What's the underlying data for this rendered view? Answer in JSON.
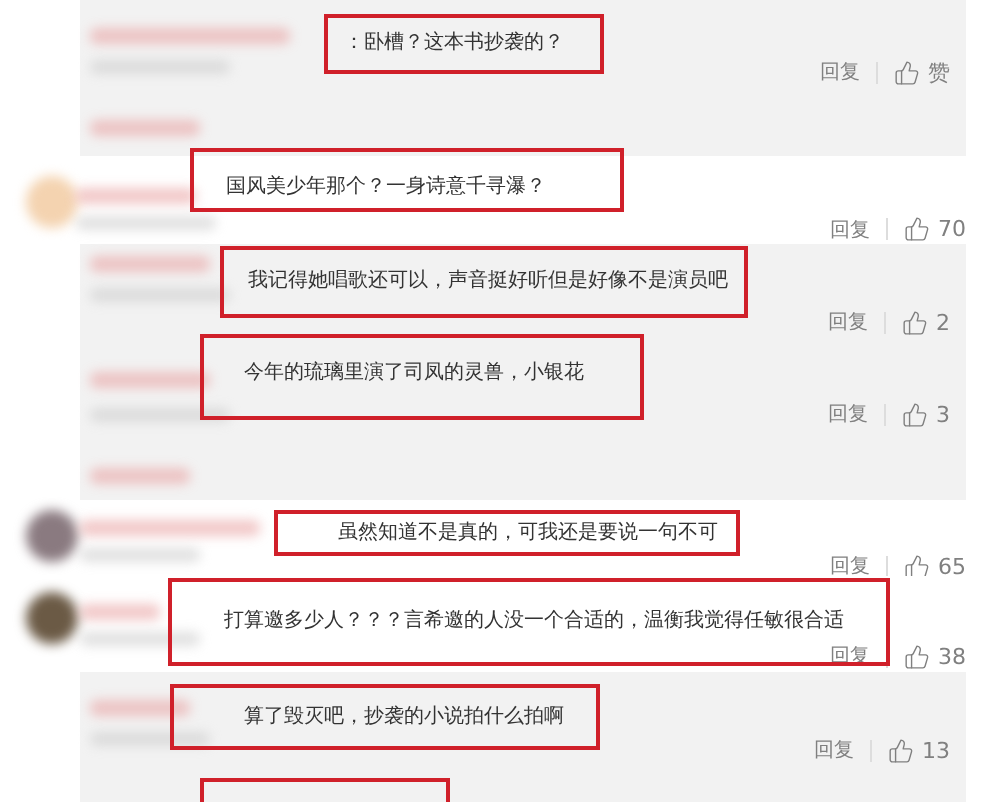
{
  "comments": [
    {
      "kind": "reply",
      "text": "：卧槽？这本书抄袭的？",
      "reply": "回复",
      "likes": "赞"
    },
    {
      "kind": "comment",
      "text": "国风美少年那个？一身诗意千寻瀑？",
      "reply": "回复",
      "likes": "70"
    },
    {
      "kind": "reply",
      "text": "我记得她唱歌还可以，声音挺好听但是好像不是演员吧",
      "reply": "回复",
      "likes": "2"
    },
    {
      "kind": "reply",
      "text": "今年的琉璃里演了司凤的灵兽，小银花",
      "reply": "回复",
      "likes": "3"
    },
    {
      "kind": "comment",
      "text": "虽然知道不是真的，可我还是要说一句不可",
      "reply": "回复",
      "likes": "65"
    },
    {
      "kind": "comment",
      "text": "打算邀多少人？？？言希邀的人没一个合适的，温衡我觉得任敏很合适",
      "reply": "回复",
      "likes": "38"
    },
    {
      "kind": "reply",
      "text": "算了毁灭吧，抄袭的小说拍什么拍啊",
      "reply": "回复",
      "likes": "13"
    }
  ]
}
